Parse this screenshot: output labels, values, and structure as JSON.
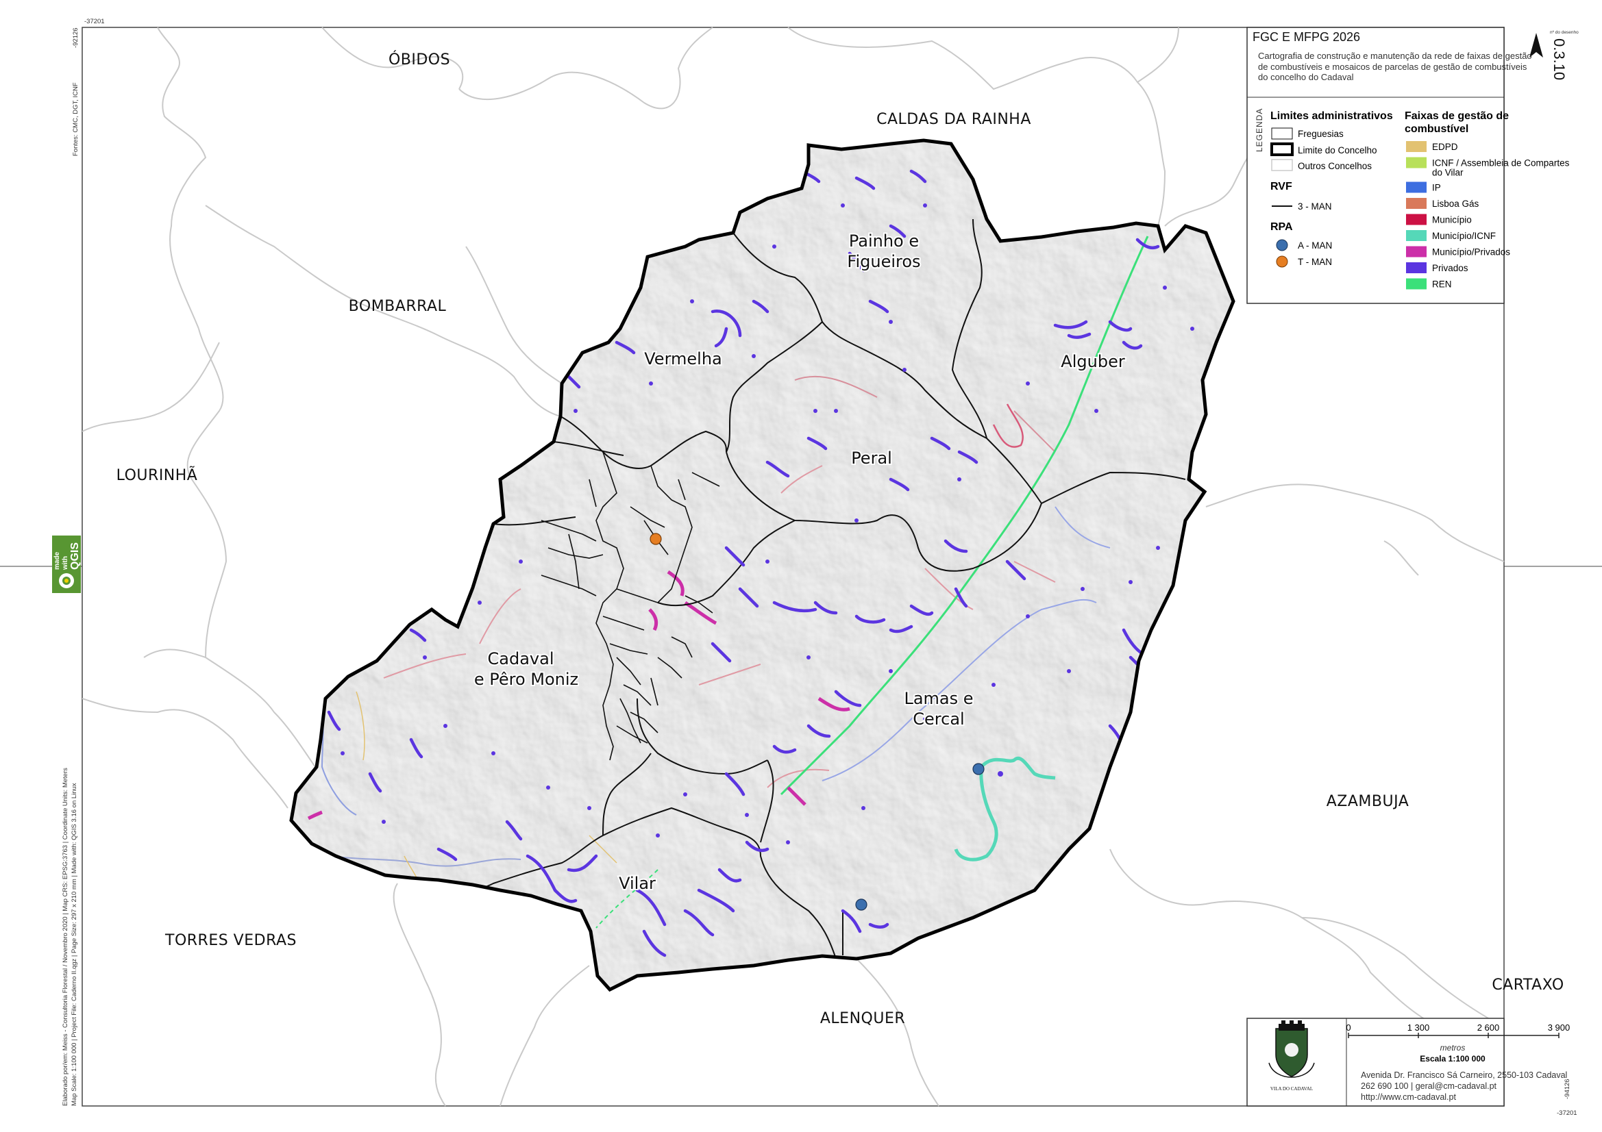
{
  "title": {
    "main": "FGC E MFPG 2026",
    "subtitle": "Cartografia de construção e manutenção da rede de faixas de gestão de combustíveis e mosaicos de parcelas de gestão de combustíveis do concelho do Cadaval",
    "drawing_no_label": "nº do desenho",
    "drawing_no": "0.3.10"
  },
  "legend": {
    "vertical_label": "LEGENDA",
    "admin_title": "Limites administrativos",
    "admin_items": [
      "Freguesias",
      "Limite do Concelho",
      "Outros Concelhos"
    ],
    "rvf_title": "RVF",
    "rvf_item": "3 - MAN",
    "rpa_title": "RPA",
    "rpa_items": [
      {
        "label": "A - MAN",
        "color": "#3b6fae"
      },
      {
        "label": "T - MAN",
        "color": "#e67e22"
      }
    ],
    "faixas_title_1": "Faixas de gestão de",
    "faixas_title_2": "combustível",
    "faixas_items": [
      {
        "label": "EDPD",
        "color": "#e2c271"
      },
      {
        "label": "ICNF / Assembleia de Compartes",
        "label2": "do Vilar",
        "color": "#b8e05a"
      },
      {
        "label": "IP",
        "color": "#3d6ee0"
      },
      {
        "label": "Lisboa Gás",
        "color": "#d9795a"
      },
      {
        "label": "Município",
        "color": "#cc1144"
      },
      {
        "label": "Município/ICNF",
        "color": "#55d8b8"
      },
      {
        "label": "Município/Privados",
        "color": "#cc2fa8"
      },
      {
        "label": "Privados",
        "color": "#5b35e0"
      },
      {
        "label": "REN",
        "color": "#3be07a"
      }
    ]
  },
  "neighbors": [
    "ÓBIDOS",
    "CALDAS DA RAINHA",
    "BOMBARRAL",
    "LOURINHÃ",
    "AZAMBUJA",
    "TORRES VEDRAS",
    "CARTAXO",
    "ALENQUER"
  ],
  "parishes": [
    {
      "line1": "Painho e",
      "line2": "Figueiros"
    },
    {
      "line1": "Vermelha",
      "line2": ""
    },
    {
      "line1": "Alguber",
      "line2": ""
    },
    {
      "line1": "Peral",
      "line2": ""
    },
    {
      "line1": "Cadaval",
      "line2": "e Pêro Moniz"
    },
    {
      "line1": "Lamas e",
      "line2": "Cercal"
    },
    {
      "line1": "Vilar",
      "line2": ""
    }
  ],
  "scale": {
    "ticks": [
      "0",
      "1 300",
      "2 600",
      "3 900"
    ],
    "unit": "metros",
    "label": "Escala 1:100 000"
  },
  "contact": {
    "address": "Avenida Dr. Francisco Sá Carneiro, 2550-103 Cadaval",
    "phone_email": "262 690 100 | geral@cm-cadaval.pt",
    "web": "http://www.cm-cadaval.pt",
    "crest_text": "VILA DO CADAVAL"
  },
  "frame": {
    "coord_top": "-37201",
    "coord_top_left": "-92126",
    "coord_bottom_right": "-37201",
    "coord_right": "-94126"
  },
  "sources": "Fontes: CMC, DGT, ICNF",
  "credits_1": "Elaborado por/em: Meiss - Consultoria Florestal / Novembro 2020 | Map CRS: EPSG:3763 | Coordinate Units: Meters",
  "credits_2": "Map Scale: 1:100 000 | Project File: Caderno II.qgz | Page Size: 297 x 210 mm | Made with: QGIS 3.16 on Linux",
  "qgis_badge": {
    "line1": "made",
    "line2": "with",
    "line3": "QGIS"
  }
}
